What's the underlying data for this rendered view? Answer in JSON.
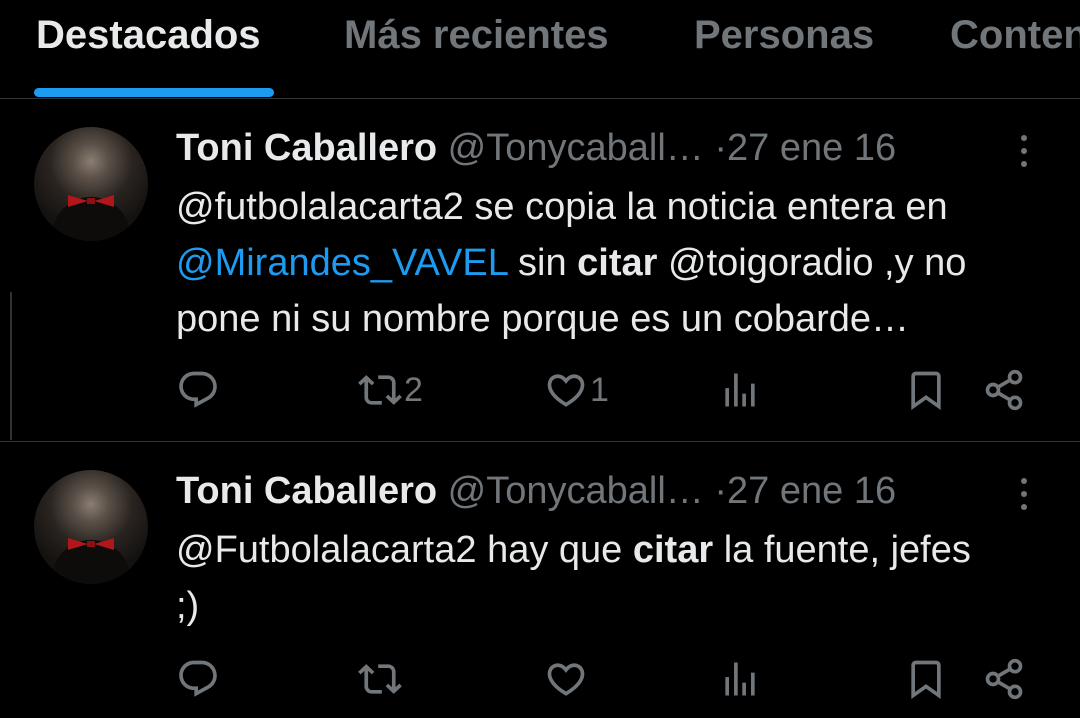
{
  "tabs": [
    {
      "label": "Destacados",
      "active": true
    },
    {
      "label": "Más recientes",
      "active": false
    },
    {
      "label": "Personas",
      "active": false
    },
    {
      "label": "Contenido",
      "active": false
    }
  ],
  "colors": {
    "accent": "#1d9bf0",
    "muted": "#71767b",
    "text": "#e7e9ea",
    "background": "#000000"
  },
  "tweets": [
    {
      "author": "Toni Caballero",
      "handle": "@Tonycaball…",
      "separator": "·",
      "date": "27 ene 16",
      "text": {
        "p1": "@futbolalacarta2 se copia la noticia entera en ",
        "link": "@Mirandes_VAVEL",
        "p2": " sin ",
        "bold": "citar",
        "p3": " @toigoradio ,y no pone ni su nombre porque es un cobarde…"
      },
      "retweets": "2",
      "likes": "1"
    },
    {
      "author": "Toni Caballero",
      "handle": "@Tonycaball…",
      "separator": "·",
      "date": "27 ene 16",
      "text": {
        "p1": "@Futbolalacarta2 hay que ",
        "bold": "citar",
        "p2": " la fuente, jefes ;)"
      }
    }
  ],
  "icons": [
    "reply-icon",
    "retweet-icon",
    "like-icon",
    "views-icon",
    "bookmark-icon",
    "share-icon",
    "more-icon"
  ]
}
